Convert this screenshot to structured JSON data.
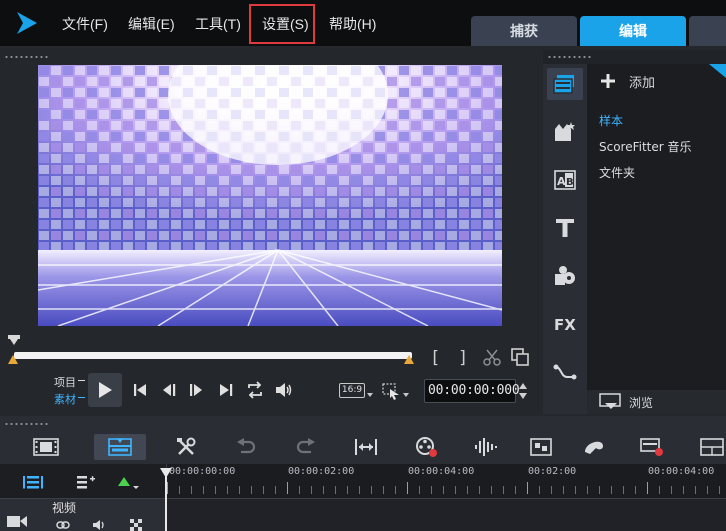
{
  "menu": {
    "items": [
      "文件(F)",
      "编辑(E)",
      "工具(T)",
      "设置(S)",
      "帮助(H)"
    ],
    "highlighted": "设置(S)"
  },
  "tabs": {
    "capture": "捕获",
    "edit": "编辑"
  },
  "preview": {
    "mode_project": "项目",
    "mode_clip": "素材",
    "aspect": "16:9",
    "timecode": "00:00:00:000"
  },
  "library": {
    "add_label": "添加",
    "items": [
      "样本",
      "ScoreFitter 音乐",
      "文件夹"
    ],
    "selected": "样本",
    "browse_label": "浏览",
    "icons": [
      "media-icon",
      "instant-project-icon",
      "transition-icon",
      "title-icon",
      "graphics-icon",
      "fx-icon",
      "path-icon"
    ]
  },
  "timeline": {
    "ruler_labels": [
      "00:00:00:00",
      "00:00:02:00",
      "00:00:04:00",
      "00:02:00",
      "00:00:04:00"
    ],
    "track_label": "视频"
  },
  "colors": {
    "accent": "#1aa3e8",
    "highlight": "#e0393e",
    "selected_text": "#3fb4ff"
  }
}
